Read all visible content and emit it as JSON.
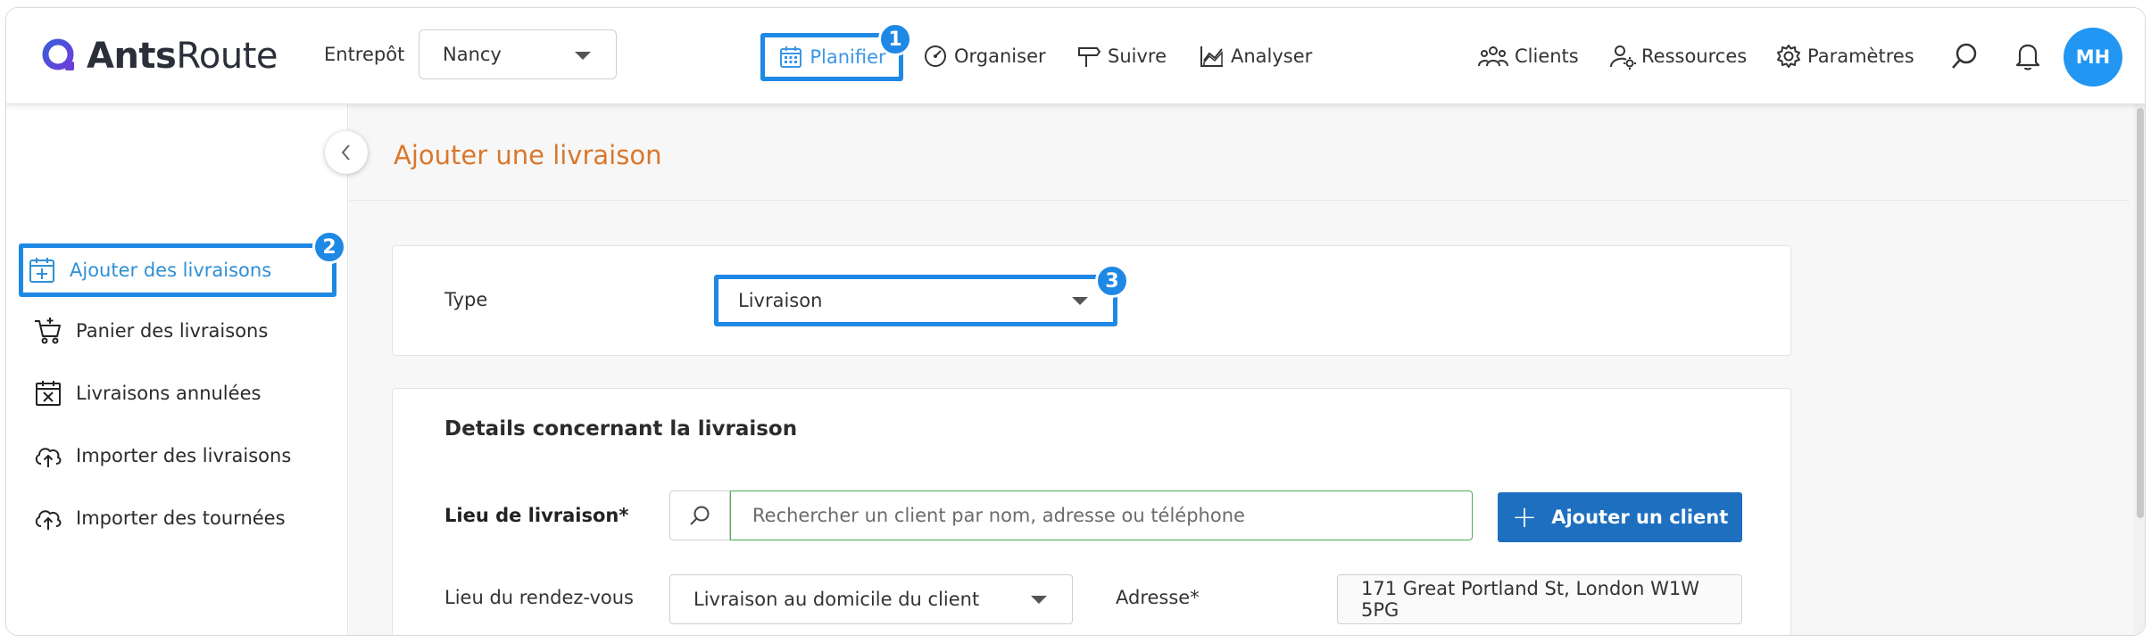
{
  "header": {
    "logo": {
      "bold": "Ants",
      "light": "Route"
    },
    "warehouse_label": "Entrepôt",
    "warehouse_value": "Nancy",
    "nav": {
      "planifier": "Planifier",
      "organiser": "Organiser",
      "suivre": "Suivre",
      "analyser": "Analyser",
      "clients": "Clients",
      "ressources": "Ressources",
      "parametres": "Paramètres"
    },
    "avatar_initials": "MH"
  },
  "badges": {
    "b1": "1",
    "b2": "2",
    "b3": "3"
  },
  "sidebar": {
    "items": [
      {
        "label": "Ajouter des livraisons",
        "icon": "calendar-plus-icon"
      },
      {
        "label": "Panier des livraisons",
        "icon": "cart-icon"
      },
      {
        "label": "Livraisons annulées",
        "icon": "calendar-x-icon"
      },
      {
        "label": "Importer des livraisons",
        "icon": "cloud-upload-icon"
      },
      {
        "label": "Importer des tournées",
        "icon": "cloud-upload-icon"
      }
    ]
  },
  "main": {
    "page_title": "Ajouter une livraison",
    "type_label": "Type",
    "type_value": "Livraison",
    "details_title": "Details concernant la livraison",
    "lieu_label": "Lieu de livraison*",
    "search_placeholder": "Rechercher un client par nom, adresse ou téléphone",
    "add_client": "Ajouter un client",
    "rdv_label": "Lieu du rendez-vous",
    "rdv_value": "Livraison au domicile du client",
    "adresse_label": "Adresse*",
    "adresse_value": "171 Great Portland St, London W1W 5PG"
  },
  "colors": {
    "accent": "#1e88e5",
    "title_orange": "#d9782d",
    "primary_button": "#1e6fbf",
    "search_border": "#4caf50"
  }
}
